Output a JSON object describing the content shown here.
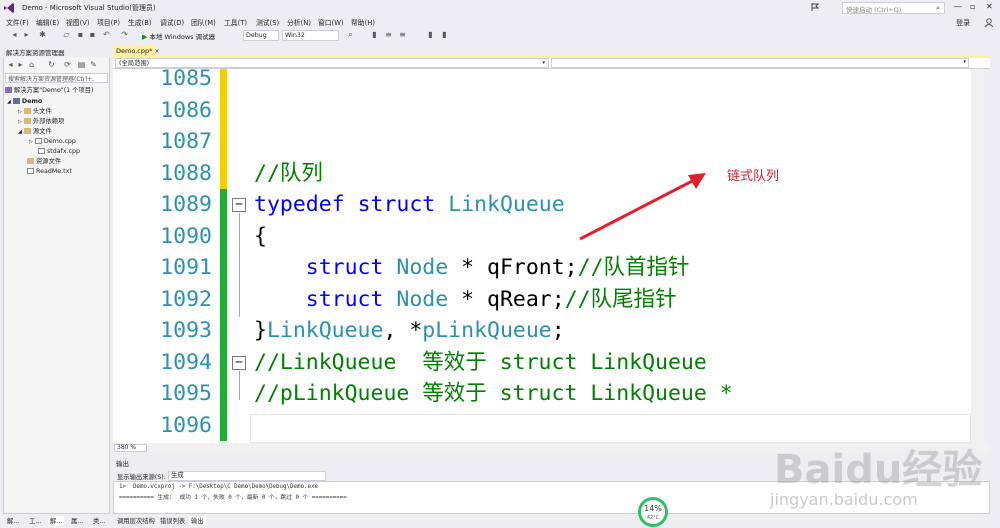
{
  "window": {
    "title": "Demo - Microsoft Visual Studio(管理员)",
    "quick_launch_placeholder": "快速启动 (Ctrl+Q)",
    "login": "登录"
  },
  "menu": [
    "文件(F)",
    "编辑(E)",
    "视图(V)",
    "项目(P)",
    "生成(B)",
    "调试(D)",
    "团队(M)",
    "工具(T)",
    "测试(S)",
    "分析(N)",
    "窗口(W)",
    "帮助(H)"
  ],
  "toolbar": {
    "run_label": "本地 Windows 调试器",
    "config": "Debug",
    "platform": "Win32"
  },
  "solution_explorer": {
    "title": "解决方案资源管理器",
    "search_placeholder": "搜索解决方案资源管理器(Ctrl+;",
    "items": [
      {
        "label": "解决方案\"Demo\"(1 个项目)",
        "icon": "solution-icon"
      },
      {
        "label": "Demo",
        "icon": "project-icon"
      },
      {
        "label": "头文件",
        "icon": "folder-icon"
      },
      {
        "label": "外部依赖项",
        "icon": "folder-icon"
      },
      {
        "label": "源文件",
        "icon": "folder-icon"
      },
      {
        "label": "Demo.cpp",
        "icon": "cpp-file-icon"
      },
      {
        "label": "stdafx.cpp",
        "icon": "cpp-file-icon"
      },
      {
        "label": "资源文件",
        "icon": "folder-icon"
      },
      {
        "label": "ReadMe.txt",
        "icon": "text-file-icon"
      }
    ],
    "bottom_tabs": [
      "解...",
      "工...",
      "解...",
      "属...",
      "类..."
    ]
  },
  "editor": {
    "tab_label": "Demo.cpp*",
    "scope": "(全局范围)",
    "zoom": "380 %",
    "lines": [
      {
        "num": "1085",
        "tokens": []
      },
      {
        "num": "1086",
        "tokens": []
      },
      {
        "num": "1087",
        "tokens": []
      },
      {
        "num": "1088",
        "tokens": [
          {
            "t": "//队列",
            "c": "cm"
          }
        ]
      },
      {
        "num": "1089",
        "tokens": [
          {
            "t": "typedef",
            "c": "kw"
          },
          {
            "t": " ",
            "c": ""
          },
          {
            "t": "struct",
            "c": "kw"
          },
          {
            "t": " ",
            "c": ""
          },
          {
            "t": "LinkQueue",
            "c": "ty"
          }
        ]
      },
      {
        "num": "1090",
        "tokens": [
          {
            "t": "{",
            "c": ""
          }
        ]
      },
      {
        "num": "1091",
        "tokens": [
          {
            "t": "    ",
            "c": ""
          },
          {
            "t": "struct",
            "c": "kw"
          },
          {
            "t": " ",
            "c": ""
          },
          {
            "t": "Node",
            "c": "ty"
          },
          {
            "t": " * qFront;",
            "c": ""
          },
          {
            "t": "//队首指针",
            "c": "cm"
          }
        ]
      },
      {
        "num": "1092",
        "tokens": [
          {
            "t": "    ",
            "c": ""
          },
          {
            "t": "struct",
            "c": "kw"
          },
          {
            "t": " ",
            "c": ""
          },
          {
            "t": "Node",
            "c": "ty"
          },
          {
            "t": " * qRear;",
            "c": ""
          },
          {
            "t": "//队尾指针",
            "c": "cm"
          }
        ]
      },
      {
        "num": "1093",
        "tokens": [
          {
            "t": "}",
            "c": ""
          },
          {
            "t": "LinkQueue",
            "c": "ty"
          },
          {
            "t": ", *",
            "c": ""
          },
          {
            "t": "pLinkQueue",
            "c": "ty"
          },
          {
            "t": ";",
            "c": ""
          }
        ]
      },
      {
        "num": "1094",
        "tokens": [
          {
            "t": "//LinkQueue  等效于 struct LinkQueue",
            "c": "cm"
          }
        ]
      },
      {
        "num": "1095",
        "tokens": [
          {
            "t": "//pLinkQueue 等效于 struct LinkQueue *",
            "c": "cm"
          }
        ]
      },
      {
        "num": "1096",
        "tokens": []
      }
    ],
    "annotation": "链式队列"
  },
  "output": {
    "title": "输出",
    "source_label": "显示输出来源(S):",
    "source_value": "生成",
    "lines": [
      "1>  Demo.vcxproj -> F:\\Desktop\\C Demo\\Demo\\Debug\\Demo.exe",
      "========== 生成:  成功 1 个，失败 0 个，最新 0 个，跳过 0 个 =========="
    ],
    "tabs": [
      "调用层次结构",
      "错误列表",
      "输出"
    ]
  },
  "status": {
    "progress_pct": "14%",
    "temperature": "42°C"
  },
  "watermark": {
    "text": "Baidu经验",
    "url": "jingyan.baidu.com"
  },
  "colors": {
    "keyword": "#0000ff",
    "type": "#2b91af",
    "comment": "#008000",
    "annotation": "#e0202c",
    "change_saved": "#1fae33",
    "change_unsaved": "#f2d000"
  }
}
